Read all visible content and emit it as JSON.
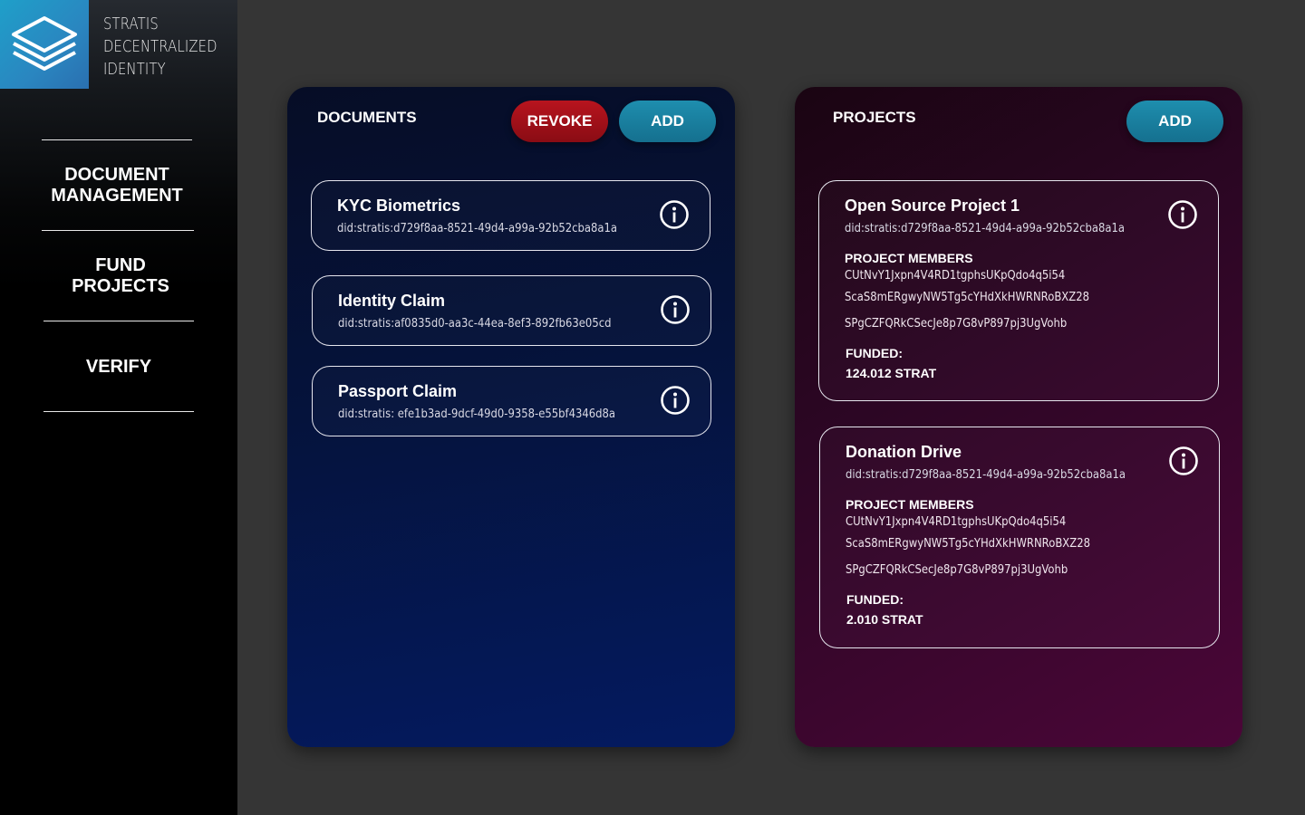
{
  "brand": {
    "lines": [
      "STRATIS",
      "DECENTRALIZED",
      "IDENTITY"
    ],
    "logo_icon": "stacked-layers-icon",
    "colors": {
      "logo_bg": "#1f9fc9"
    }
  },
  "nav": {
    "items": [
      {
        "line1": "DOCUMENT",
        "line2": "MANAGEMENT"
      },
      {
        "line1": "FUND",
        "line2": "PROJECTS"
      },
      {
        "line1": "VERIFY",
        "line2": ""
      }
    ]
  },
  "documents": {
    "title": "DOCUMENTS",
    "revoke_label": "REVOKE",
    "add_label": "ADD",
    "items": [
      {
        "title": "KYC Biometrics",
        "did": "did:stratis:d729f8aa-8521-49d4-a99a-92b52cba8a1a"
      },
      {
        "title": "Identity Claim",
        "did": "did:stratis:af0835d0-aa3c-44ea-8ef3-892fb63e05cd"
      },
      {
        "title": "Passport Claim",
        "did": "did:stratis: efe1b3ad-9dcf-49d0-9358-e55bf4346d8a"
      }
    ]
  },
  "projects": {
    "title": "PROJECTS",
    "add_label": "ADD",
    "members_label": "PROJECT MEMBERS",
    "funded_label": "FUNDED:",
    "items": [
      {
        "title": "Open Source Project 1",
        "did": "did:stratis:d729f8aa-8521-49d4-a99a-92b52cba8a1a",
        "members": [
          "CUtNvY1Jxpn4V4RD1tgphsUKpQdo4q5i54",
          "ScaS8mERgwyNW5Tg5cYHdXkHWRNRoBXZ28",
          "SPgCZFQRkCSecJe8p7G8vP897pj3UgVohb"
        ],
        "funded": "124.012 STRAT"
      },
      {
        "title": "Donation Drive",
        "did": "did:stratis:d729f8aa-8521-49d4-a99a-92b52cba8a1a",
        "members": [
          "CUtNvY1Jxpn4V4RD1tgphsUKpQdo4q5i54",
          "ScaS8mERgwyNW5Tg5cYHdXkHWRNRoBXZ28",
          "SPgCZFQRkCSecJe8p7G8vP897pj3UgVohb"
        ],
        "funded": "2.010 STRAT"
      }
    ]
  },
  "colors": {
    "revoke": "#b8141e",
    "add": "#1e8eae",
    "documents_panel": "#05133c",
    "projects_panel": "#4b0638"
  }
}
